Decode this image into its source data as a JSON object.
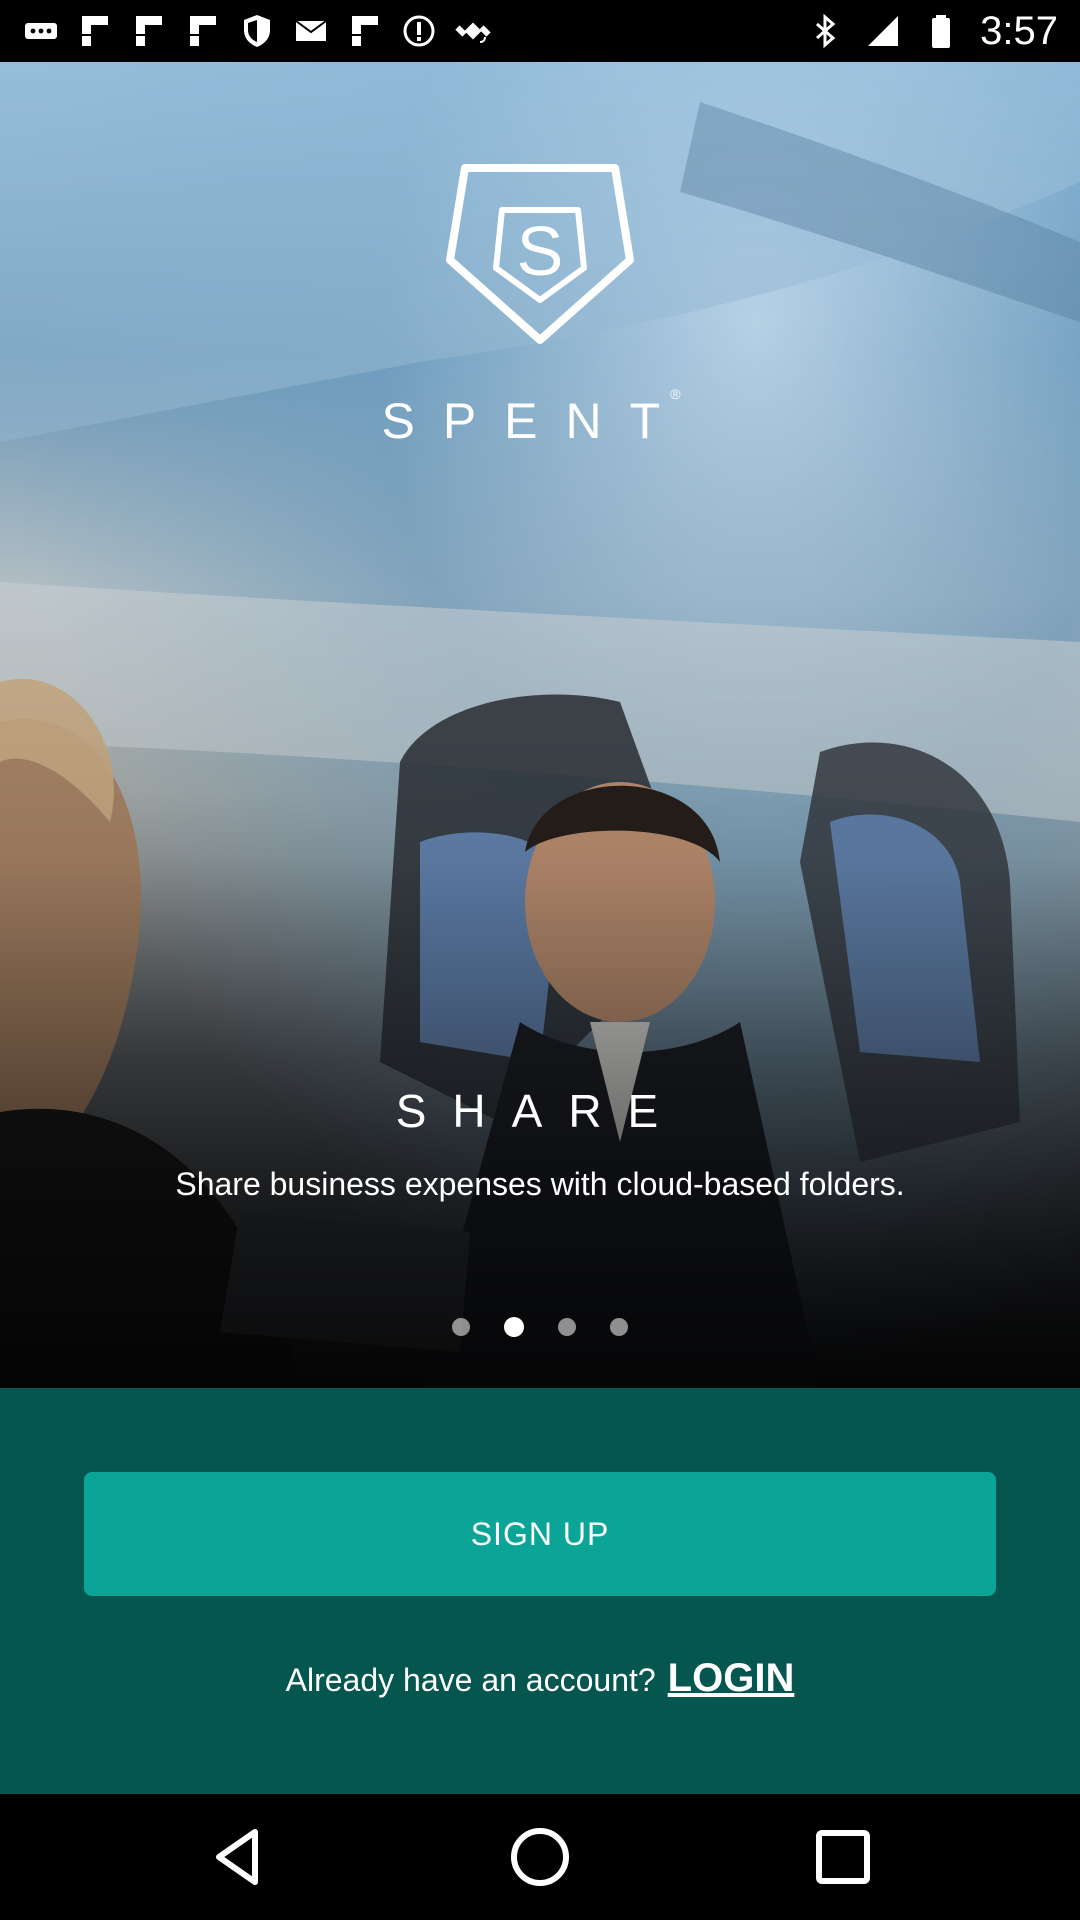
{
  "status_bar": {
    "time": "3:57",
    "left_icons": [
      "more-icon",
      "flipboard-icon",
      "flipboard-icon",
      "flipboard-icon",
      "shield-icon",
      "mail-icon",
      "flipboard-icon",
      "info-icon",
      "satellite-fake-gps-icon"
    ],
    "right_icons": [
      "bluetooth-icon",
      "signal-icon",
      "battery-icon"
    ]
  },
  "hero": {
    "brand": "SPENT",
    "brand_mark": "®",
    "logo_letter": "S",
    "section_title": "SHARE",
    "description": "Share business expenses with cloud-based folders.",
    "pager": {
      "count": 4,
      "active_index": 1
    }
  },
  "actions": {
    "signup_label": "SIGN UP",
    "login_prompt": "Already have an account?",
    "login_label": "LOGIN"
  },
  "colors": {
    "panel_bg": "#065650",
    "signup_bg": "#0aa597"
  },
  "nav": [
    "back-icon",
    "home-icon",
    "recents-icon"
  ]
}
